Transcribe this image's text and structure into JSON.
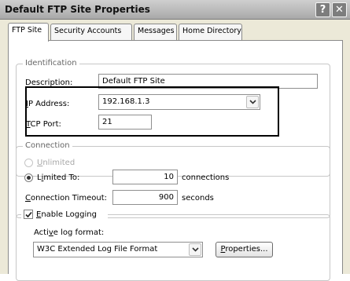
{
  "window": {
    "title": "Default FTP Site Properties",
    "help_label": "?",
    "close_label": "✕"
  },
  "tabs": [
    {
      "label": "FTP Site",
      "active": true
    },
    {
      "label": "Security Accounts",
      "active": false
    },
    {
      "label": "Messages",
      "active": false
    },
    {
      "label": "Home Directory",
      "active": false
    }
  ],
  "identification": {
    "legend": "Identification",
    "description_label": "Description:",
    "description_value": "Default FTP Site",
    "ip_label_accel": "I",
    "ip_label_rest": "P Address:",
    "ip_value": "192.168.1.3",
    "port_label_accel": "T",
    "port_label_rest": "CP Port:",
    "port_value": "21"
  },
  "connection": {
    "legend": "Connection",
    "unlimited_accel": "U",
    "unlimited_rest": "nlimited",
    "limited_pre": "L",
    "limited_accel": "i",
    "limited_rest": "mited To:",
    "limited_value": "10",
    "limited_unit": "connections",
    "timeout_accel": "C",
    "timeout_rest": "onnection Timeout:",
    "timeout_value": "900",
    "timeout_unit": "seconds"
  },
  "logging": {
    "enable_accel": "E",
    "enable_rest": "nable Logging",
    "enabled": true,
    "format_label_pre": "Acti",
    "format_label_accel": "v",
    "format_label_rest": "e log format:",
    "format_value": "W3C Extended Log File Format",
    "properties_accel": "P",
    "properties_rest": "roperties..."
  },
  "colors": {
    "title_bar": "#a9a9a9",
    "dialog_bg": "#ece9d8",
    "highlight_border": "#000000"
  }
}
